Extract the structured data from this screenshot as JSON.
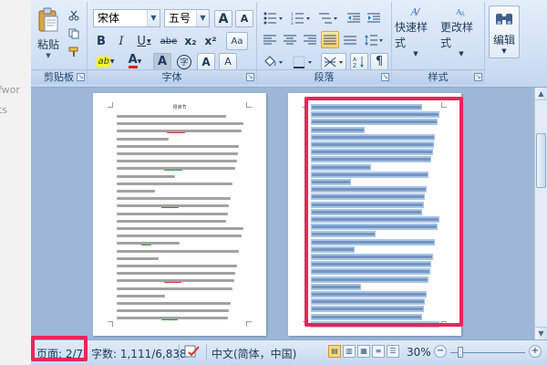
{
  "gutter": {
    "fragments": [
      "fwor",
      "ts"
    ]
  },
  "ribbon": {
    "clipboard": {
      "label": "剪贴板",
      "paste_label": "粘贴"
    },
    "font": {
      "label": "字体",
      "font_name": "宋体",
      "font_size": "五号",
      "bold": "B",
      "italic": "I",
      "underline": "U",
      "strikethrough": "abe",
      "subscript": "x₂",
      "superscript": "x²",
      "grow": "A",
      "shrink": "A",
      "char_shading": "A",
      "enclose": "字",
      "phonetic": "A",
      "highlight": "ab",
      "font_color": "A",
      "change_case": "Aa"
    },
    "paragraph": {
      "label": "段落"
    },
    "styles": {
      "label": "样式",
      "quick_styles": "快速样式",
      "change_styles": "更改样式"
    },
    "editing": {
      "label": "编辑"
    }
  },
  "document": {
    "page1_title": "母亲节"
  },
  "status": {
    "page": "页面: 2/7",
    "words": "字数: 1,111/6,838",
    "language": "中文(简体，中国)",
    "zoom": "30%"
  },
  "colors": {
    "accent_red": "#e8265a",
    "ribbon_bg": "#cfdff3",
    "selection": "#a8c4e8"
  }
}
